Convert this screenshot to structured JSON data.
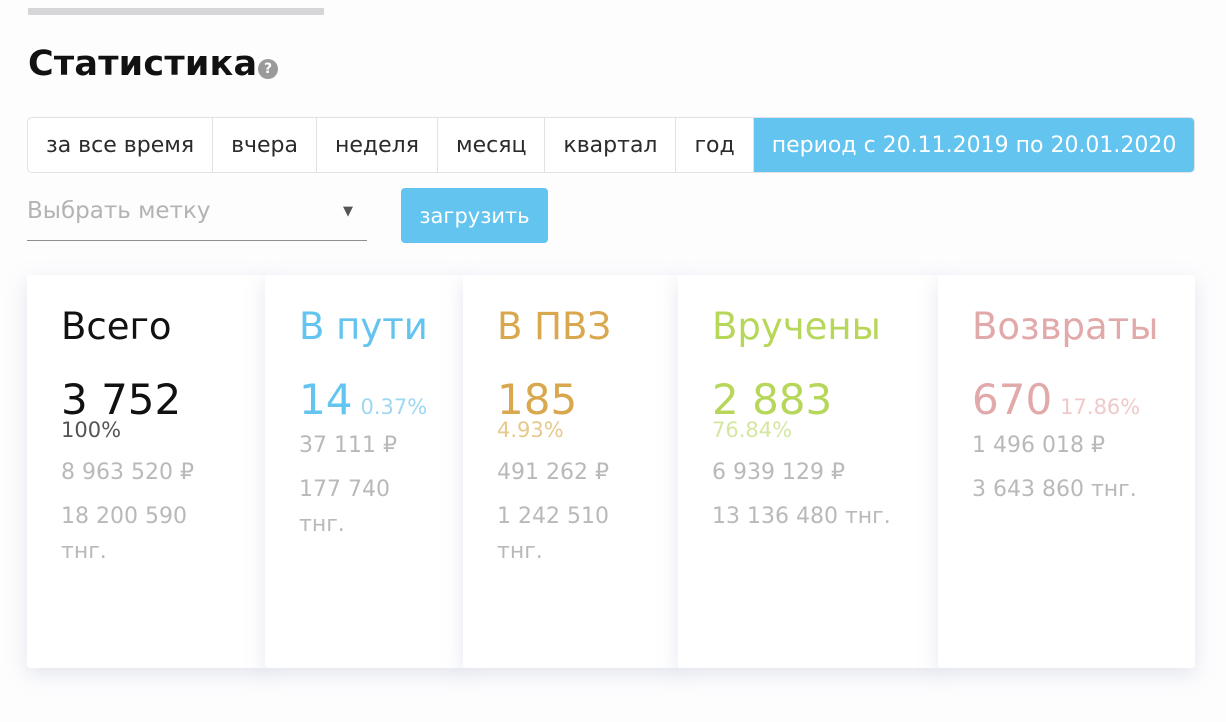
{
  "header": {
    "title": "Статистика",
    "help_glyph": "?"
  },
  "periods": {
    "tabs": [
      "за все время",
      "вчера",
      "неделя",
      "месяц",
      "квартал",
      "год"
    ],
    "active": "период с 20.11.2019 по 20.01.2020"
  },
  "filter": {
    "placeholder": "Выбрать метку",
    "caret": "▼"
  },
  "load_button": "загрузить",
  "cards": {
    "total": {
      "label": "Всего",
      "count": "3 752",
      "percent": "100%",
      "amount_rub": "8 963 520 ₽",
      "amount_tng": "18 200 590 тнг."
    },
    "in_transit": {
      "label": "В пути",
      "count": "14",
      "percent": "0.37%",
      "amount_rub": "37 111 ₽",
      "amount_tng": "177 740 тнг."
    },
    "at_pickup": {
      "label": "В ПВЗ",
      "count": "185",
      "percent": "4.93%",
      "amount_rub": "491 262 ₽",
      "amount_tng": "1 242 510 тнг."
    },
    "delivered": {
      "label": "Вручены",
      "count": "2 883",
      "percent": "76.84%",
      "amount_rub": "6 939 129 ₽",
      "amount_tng": "13 136 480 тнг."
    },
    "returns": {
      "label": "Возвраты",
      "count": "670",
      "percent": "17.86%",
      "amount_rub": "1 496 018 ₽",
      "amount_tng": "3 643 860 тнг."
    }
  },
  "colors": {
    "accent": "#62c4ef",
    "total": "#111111",
    "in_transit": "#62c4ef",
    "at_pickup": "#d9a84e",
    "delivered": "#b7d75a",
    "returns": "#e2a9ab"
  }
}
